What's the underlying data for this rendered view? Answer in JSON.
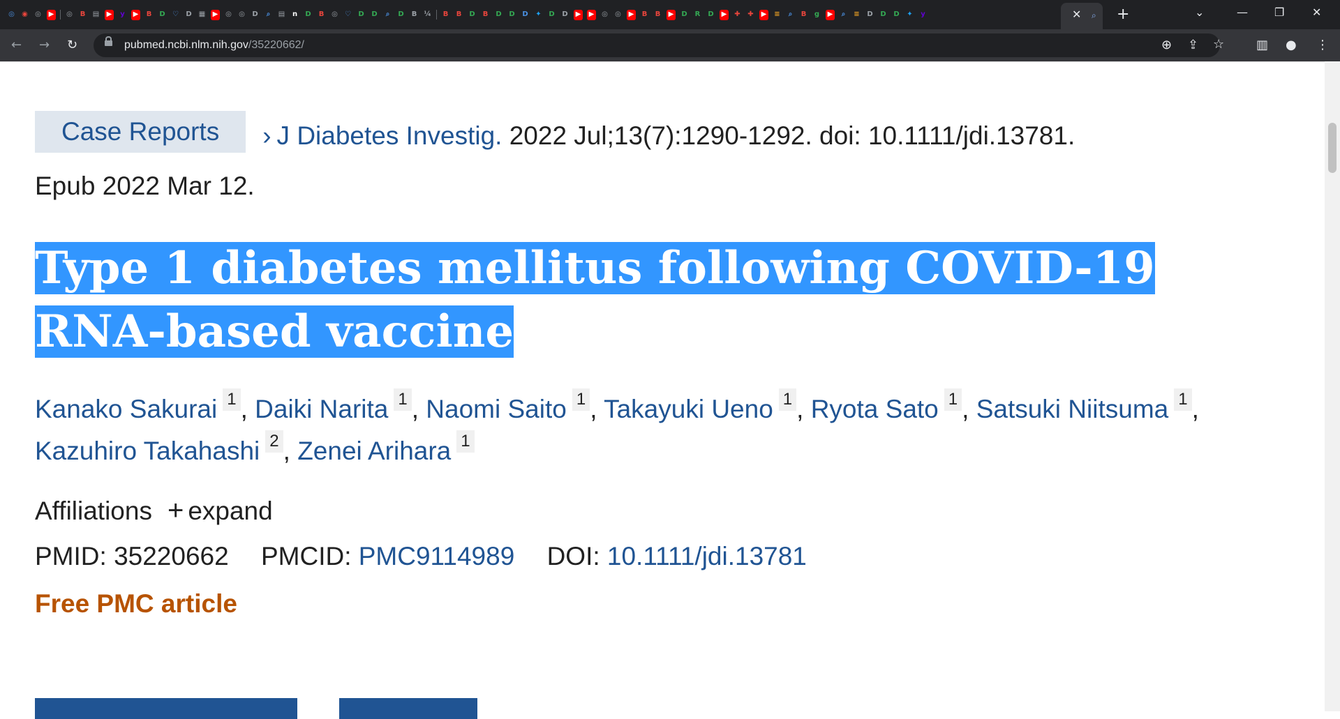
{
  "browser": {
    "tab_favicons": [
      {
        "icon": "chrome-icon",
        "color": "#4a90e2",
        "glyph": "◎"
      },
      {
        "icon": "app-icon",
        "color": "#e8453c",
        "glyph": "◉"
      },
      {
        "icon": "globe-icon",
        "color": "#9aa0a6",
        "glyph": "◎"
      },
      {
        "icon": "youtube-icon",
        "color": "#ff0000",
        "glyph": "▶"
      },
      {
        "icon": "sep",
        "color": "",
        "glyph": ""
      },
      {
        "icon": "globe-icon",
        "color": "#9aa0a6",
        "glyph": "◎"
      },
      {
        "icon": "b-icon",
        "color": "#e8453c",
        "glyph": "B"
      },
      {
        "icon": "doc-icon",
        "color": "#9aa0a6",
        "glyph": "▤"
      },
      {
        "icon": "youtube-icon",
        "color": "#ff0000",
        "glyph": "▶"
      },
      {
        "icon": "yahoo-icon",
        "color": "#6001d2",
        "glyph": "y"
      },
      {
        "icon": "youtube-icon",
        "color": "#ff0000",
        "glyph": "▶"
      },
      {
        "icon": "b-icon",
        "color": "#e8453c",
        "glyph": "B"
      },
      {
        "icon": "play-icon",
        "color": "#34a853",
        "glyph": "D"
      },
      {
        "icon": "heart-icon",
        "color": "#4a90e2",
        "glyph": "♡"
      },
      {
        "icon": "play-icon",
        "color": "#9aa0a6",
        "glyph": "D"
      },
      {
        "icon": "image-icon",
        "color": "#9aa0a6",
        "glyph": "▦"
      },
      {
        "icon": "youtube-icon",
        "color": "#ff0000",
        "glyph": "▶"
      },
      {
        "icon": "globe-icon",
        "color": "#9aa0a6",
        "glyph": "◎"
      },
      {
        "icon": "globe-icon",
        "color": "#9aa0a6",
        "glyph": "◎"
      },
      {
        "icon": "play-icon",
        "color": "#9aa0a6",
        "glyph": "D"
      },
      {
        "icon": "search-icon",
        "color": "#4a90e2",
        "glyph": "⌕"
      },
      {
        "icon": "doc-icon",
        "color": "#9aa0a6",
        "glyph": "▤"
      },
      {
        "icon": "n-icon",
        "color": "#ffffff",
        "glyph": "n"
      },
      {
        "icon": "play-icon",
        "color": "#34a853",
        "glyph": "D"
      },
      {
        "icon": "b-icon",
        "color": "#e8453c",
        "glyph": "B"
      },
      {
        "icon": "globe-icon",
        "color": "#9aa0a6",
        "glyph": "◎"
      },
      {
        "icon": "heart-icon",
        "color": "#4a90e2",
        "glyph": "♡"
      },
      {
        "icon": "play-icon",
        "color": "#34a853",
        "glyph": "D"
      },
      {
        "icon": "play-icon",
        "color": "#34a853",
        "glyph": "D"
      },
      {
        "icon": "search-icon",
        "color": "#4a90e2",
        "glyph": "⌕"
      },
      {
        "icon": "play-icon",
        "color": "#34a853",
        "glyph": "D"
      },
      {
        "icon": "b-icon",
        "color": "#9aa0a6",
        "glyph": "B"
      },
      {
        "icon": "note-icon",
        "color": "#9aa0a6",
        "glyph": "¼"
      },
      {
        "icon": "sep",
        "color": "",
        "glyph": ""
      },
      {
        "icon": "b-icon",
        "color": "#e8453c",
        "glyph": "B"
      },
      {
        "icon": "b-icon",
        "color": "#e8453c",
        "glyph": "B"
      },
      {
        "icon": "play-icon",
        "color": "#34a853",
        "glyph": "D"
      },
      {
        "icon": "b-icon",
        "color": "#e8453c",
        "glyph": "B"
      },
      {
        "icon": "play-icon",
        "color": "#34a853",
        "glyph": "D"
      },
      {
        "icon": "play-icon",
        "color": "#34a853",
        "glyph": "D"
      },
      {
        "icon": "da-icon",
        "color": "#4a90e2",
        "glyph": "D"
      },
      {
        "icon": "twitter-icon",
        "color": "#1da1f2",
        "glyph": "✦"
      },
      {
        "icon": "play-icon",
        "color": "#34a853",
        "glyph": "D"
      },
      {
        "icon": "play-icon",
        "color": "#9aa0a6",
        "glyph": "D"
      },
      {
        "icon": "youtube-icon",
        "color": "#ff0000",
        "glyph": "▶"
      },
      {
        "icon": "youtube-icon",
        "color": "#ff0000",
        "glyph": "▶"
      },
      {
        "icon": "globe-icon",
        "color": "#9aa0a6",
        "glyph": "◎"
      },
      {
        "icon": "globe-icon",
        "color": "#9aa0a6",
        "glyph": "◎"
      },
      {
        "icon": "youtube-icon",
        "color": "#ff0000",
        "glyph": "▶"
      },
      {
        "icon": "b-icon",
        "color": "#e8453c",
        "glyph": "B"
      },
      {
        "icon": "b-icon",
        "color": "#e8453c",
        "glyph": "B"
      },
      {
        "icon": "youtube-icon",
        "color": "#ff0000",
        "glyph": "▶"
      },
      {
        "icon": "play-icon",
        "color": "#34a853",
        "glyph": "D"
      },
      {
        "icon": "r-icon",
        "color": "#34a853",
        "glyph": "R"
      },
      {
        "icon": "play-icon",
        "color": "#34a853",
        "glyph": "D"
      },
      {
        "icon": "youtube-icon",
        "color": "#ff0000",
        "glyph": "▶"
      },
      {
        "icon": "flag-icon",
        "color": "#e8453c",
        "glyph": "✚"
      },
      {
        "icon": "flag-icon",
        "color": "#e8453c",
        "glyph": "✚"
      },
      {
        "icon": "youtube-icon",
        "color": "#ff0000",
        "glyph": "▶"
      },
      {
        "icon": "bookmark-icon",
        "color": "#f5a623",
        "glyph": "≡"
      },
      {
        "icon": "search-icon",
        "color": "#4a90e2",
        "glyph": "⌕"
      },
      {
        "icon": "b-icon",
        "color": "#e8453c",
        "glyph": "B"
      },
      {
        "icon": "g-icon",
        "color": "#34a853",
        "glyph": "g"
      },
      {
        "icon": "youtube-icon",
        "color": "#ff0000",
        "glyph": "▶"
      },
      {
        "icon": "search-icon",
        "color": "#4a90e2",
        "glyph": "⌕"
      },
      {
        "icon": "bookmark-icon",
        "color": "#f5a623",
        "glyph": "≡"
      },
      {
        "icon": "play-icon",
        "color": "#9aa0a6",
        "glyph": "D"
      },
      {
        "icon": "play-icon",
        "color": "#34a853",
        "glyph": "D"
      },
      {
        "icon": "play-icon",
        "color": "#34a853",
        "glyph": "D"
      },
      {
        "icon": "twitter-icon",
        "color": "#1da1f2",
        "glyph": "✦"
      },
      {
        "icon": "yahoo-icon",
        "color": "#6001d2",
        "glyph": "y"
      }
    ],
    "url_host": "pubmed.ncbi.nlm.nih.gov",
    "url_path": "/35220662/",
    "colors": {
      "frame": "#202124",
      "toolbar": "#35363a",
      "text": "#e8eaed"
    }
  },
  "article": {
    "type_badge": "Case Reports",
    "journal": "J Diabetes Investig.",
    "citation": "2022 Jul;13(7):1290-1292. doi: 10.1111/jdi.13781.",
    "epub": "Epub 2022 Mar 12.",
    "title": "Type 1 diabetes mellitus following COVID-19 RNA-based vaccine",
    "authors": [
      {
        "name": "Kanako Sakurai",
        "aff": "1"
      },
      {
        "name": "Daiki Narita",
        "aff": "1"
      },
      {
        "name": "Naomi Saito",
        "aff": "1"
      },
      {
        "name": "Takayuki Ueno",
        "aff": "1"
      },
      {
        "name": "Ryota Sato",
        "aff": "1"
      },
      {
        "name": "Satsuki Niitsuma",
        "aff": "1"
      },
      {
        "name": "Kazuhiro Takahashi",
        "aff": "2"
      },
      {
        "name": "Zenei Arihara",
        "aff": "1"
      }
    ],
    "affiliations_label": "Affiliations",
    "expand_label": "expand",
    "pmid_label": "PMID:",
    "pmid": "35220662",
    "pmcid_label": "PMCID:",
    "pmcid": "PMC9114989",
    "doi_label": "DOI:",
    "doi": "10.1111/jdi.13781",
    "free_label": "Free PMC article",
    "colors": {
      "link": "#205493",
      "highlight": "#3296ff",
      "free": "#b75300",
      "badge_bg": "#dfe6ee"
    }
  }
}
